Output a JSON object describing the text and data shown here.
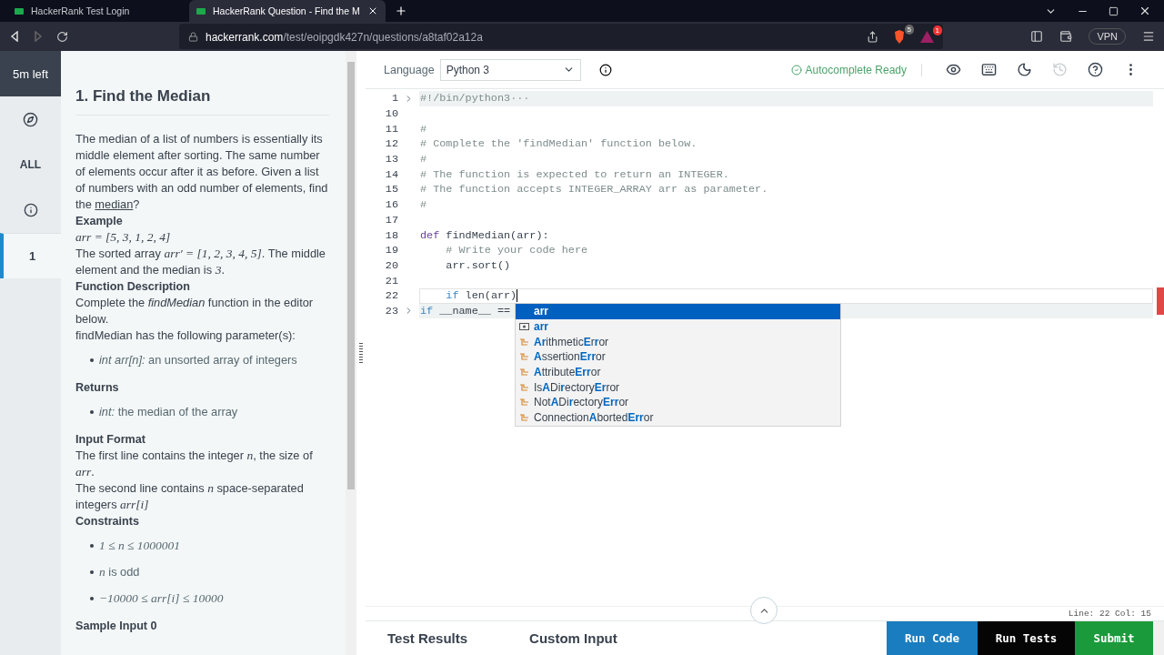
{
  "browser": {
    "tabs": [
      {
        "title": "HackerRank Test Login",
        "selected": false
      },
      {
        "title": "HackerRank Question - Find the M",
        "selected": true
      }
    ],
    "address": {
      "host": "hackerrank.com",
      "path": "/test/eoipgdk427n/questions/a8taf02a12a"
    },
    "shield_count": "5",
    "alert_count": "1",
    "vpn": "VPN"
  },
  "rail": {
    "timer": "5m left",
    "filter": "ALL",
    "questions": [
      {
        "label": "1",
        "selected": true
      }
    ]
  },
  "problem": {
    "title": "1. Find the Median",
    "blocks": [
      {
        "kind": "para",
        "parts": [
          {
            "kind": "text",
            "text": "The median of a list of numbers is essentially its middle element after sorting. The same number of elements occur after it as before. Given a list of numbers with an odd number of elements, find the "
          },
          {
            "kind": "link",
            "text": "median"
          },
          {
            "kind": "text",
            "text": "?"
          }
        ]
      },
      {
        "kind": "heading",
        "text": "Example"
      },
      {
        "kind": "para",
        "parts": [
          {
            "kind": "math",
            "text": "arr = [5, 3, 1, 2, 4]"
          }
        ]
      },
      {
        "kind": "para",
        "parts": [
          {
            "kind": "text",
            "text": "The sorted array "
          },
          {
            "kind": "math",
            "text": "arr′ = [1, 2, 3, 4, 5]"
          },
          {
            "kind": "text",
            "text": ". The middle element and the median is "
          },
          {
            "kind": "math",
            "text": "3"
          },
          {
            "kind": "text",
            "text": "."
          }
        ]
      },
      {
        "kind": "heading",
        "text": "Function Description"
      },
      {
        "kind": "para",
        "parts": [
          {
            "kind": "text",
            "text": "Complete the "
          },
          {
            "kind": "em",
            "text": "findMedian"
          },
          {
            "kind": "text",
            "text": " function in the editor below."
          }
        ]
      },
      {
        "kind": "para",
        "parts": [
          {
            "kind": "text",
            "text": "findMedian has the following parameter(s):"
          }
        ]
      },
      {
        "kind": "bullets",
        "items": [
          [
            {
              "kind": "em",
              "text": "int arr[n]:"
            },
            {
              "kind": "text",
              "text": " an unsorted array of integers"
            }
          ]
        ]
      },
      {
        "kind": "heading",
        "text": "Returns"
      },
      {
        "kind": "bullets",
        "items": [
          [
            {
              "kind": "em",
              "text": "int:"
            },
            {
              "kind": "text",
              "text": " the median of the array"
            }
          ]
        ]
      },
      {
        "kind": "heading",
        "text": "Input Format"
      },
      {
        "kind": "para",
        "parts": [
          {
            "kind": "text",
            "text": "The first line contains the integer "
          },
          {
            "kind": "math",
            "text": "n"
          },
          {
            "kind": "text",
            "text": ", the size of "
          },
          {
            "kind": "math",
            "text": "arr"
          },
          {
            "kind": "text",
            "text": "."
          }
        ]
      },
      {
        "kind": "para",
        "parts": [
          {
            "kind": "text",
            "text": "The second line contains "
          },
          {
            "kind": "math",
            "text": "n"
          },
          {
            "kind": "text",
            "text": " space-separated integers "
          },
          {
            "kind": "math",
            "text": "arr[i]"
          }
        ]
      },
      {
        "kind": "heading",
        "text": "Constraints"
      },
      {
        "kind": "bullets",
        "items": [
          [
            {
              "kind": "math",
              "text": "1 ≤ n ≤ 1000001"
            }
          ],
          [
            {
              "kind": "math",
              "text": "n"
            },
            {
              "kind": "text",
              "text": " is odd"
            }
          ],
          [
            {
              "kind": "math",
              "text": "−10000 ≤ arr[i] ≤ 10000"
            }
          ]
        ]
      },
      {
        "kind": "heading",
        "text": "Sample Input 0"
      }
    ]
  },
  "editor": {
    "language_label": "Language",
    "language": "Python 3",
    "status": "Autocomplete Ready",
    "tools": [
      {
        "kind": "eye",
        "disabled": false
      },
      {
        "kind": "keyboard",
        "disabled": false
      },
      {
        "kind": "moon",
        "disabled": false
      },
      {
        "kind": "history",
        "disabled": true
      },
      {
        "kind": "help",
        "disabled": false
      },
      {
        "kind": "more",
        "disabled": false
      }
    ],
    "lines": [
      {
        "number": "1",
        "folded": true,
        "current": false,
        "tokens": [
          {
            "kind": "comment",
            "text": "#!/bin/python3"
          },
          {
            "kind": "fold",
            "text": "···"
          }
        ]
      },
      {
        "number": "10",
        "folded": false,
        "current": false
      },
      {
        "number": "11",
        "folded": false,
        "current": false,
        "tokens": [
          {
            "kind": "comment",
            "text": "#"
          }
        ]
      },
      {
        "number": "12",
        "folded": false,
        "current": false,
        "tokens": [
          {
            "kind": "comment",
            "text": "# Complete the 'findMedian' function below."
          }
        ]
      },
      {
        "number": "13",
        "folded": false,
        "current": false,
        "tokens": [
          {
            "kind": "comment",
            "text": "#"
          }
        ]
      },
      {
        "number": "14",
        "folded": false,
        "current": false,
        "tokens": [
          {
            "kind": "comment",
            "text": "# The function is expected to return an INTEGER."
          }
        ]
      },
      {
        "number": "15",
        "folded": false,
        "current": false,
        "tokens": [
          {
            "kind": "comment",
            "text": "# The function accepts INTEGER_ARRAY arr as parameter."
          }
        ]
      },
      {
        "number": "16",
        "folded": false,
        "current": false,
        "tokens": [
          {
            "kind": "comment",
            "text": "#"
          }
        ]
      },
      {
        "number": "17",
        "folded": false,
        "current": false
      },
      {
        "number": "18",
        "folded": false,
        "current": false,
        "tokens": [
          {
            "kind": "keyword",
            "text": "def"
          },
          {
            "kind": "plain",
            "text": " findMedian(arr):"
          }
        ]
      },
      {
        "number": "19",
        "folded": false,
        "current": false,
        "tokens": [
          {
            "kind": "comment",
            "text": "    # Write your code here"
          }
        ]
      },
      {
        "number": "20",
        "folded": false,
        "current": false,
        "tokens": [
          {
            "kind": "plain",
            "text": "    arr.sort()"
          }
        ]
      },
      {
        "number": "21",
        "folded": false,
        "current": false
      },
      {
        "number": "22",
        "folded": false,
        "current": true,
        "tokens": [
          {
            "kind": "keyword2",
            "text": "    if"
          },
          {
            "kind": "plain",
            "text": " len(arr)"
          }
        ]
      },
      {
        "number": "23",
        "folded": true,
        "current": false,
        "tokens": [
          {
            "kind": "keyword2",
            "text": "if"
          },
          {
            "kind": "plain",
            "text": " __name__ =="
          }
        ]
      }
    ],
    "suggestions": [
      {
        "label": "**arr**",
        "kind": "text",
        "selected": true
      },
      {
        "label": "**arr**",
        "kind": "variable",
        "selected": false
      },
      {
        "label": "**Ar**ithmetic**E**r**r**or",
        "kind": "class",
        "selected": false
      },
      {
        "label": "**A**ssertion**Err**or",
        "kind": "class",
        "selected": false
      },
      {
        "label": "**A**ttribute**Err**or",
        "kind": "class",
        "selected": false
      },
      {
        "label": "Is**A**Di**r**ectory**Er**ror",
        "kind": "class",
        "selected": false
      },
      {
        "label": "Not**A**Di**r**ectory**Err**or",
        "kind": "class",
        "selected": false
      },
      {
        "label": "Connection**A**borted**Err**or",
        "kind": "class",
        "selected": false
      }
    ],
    "cursor": "Line: 22 Col: 15",
    "panel_tabs": [
      "Test Results",
      "Custom Input"
    ],
    "actions": [
      {
        "label": "Run Code",
        "kind": "run"
      },
      {
        "label": "Run Tests",
        "kind": "tests"
      },
      {
        "label": "Submit",
        "kind": "submit"
      }
    ]
  }
}
